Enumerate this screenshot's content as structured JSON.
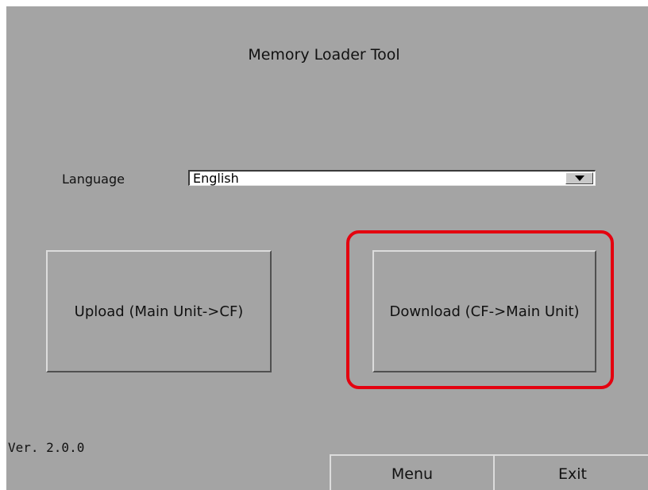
{
  "app": {
    "title": "Memory Loader Tool"
  },
  "language": {
    "label": "Language",
    "selected": "English",
    "dropdown_icon": "triangle-down-icon"
  },
  "actions": {
    "upload_label": "Upload (Main Unit->CF)",
    "download_label": "Download (CF->Main Unit)"
  },
  "highlight": {
    "color": "#e4000f",
    "target": "download-button"
  },
  "footer": {
    "version": "Ver. 2.0.0",
    "menu_label": "Menu",
    "exit_label": "Exit"
  },
  "colors": {
    "background": "#a4a4a4",
    "annotation": "#e4000f"
  }
}
